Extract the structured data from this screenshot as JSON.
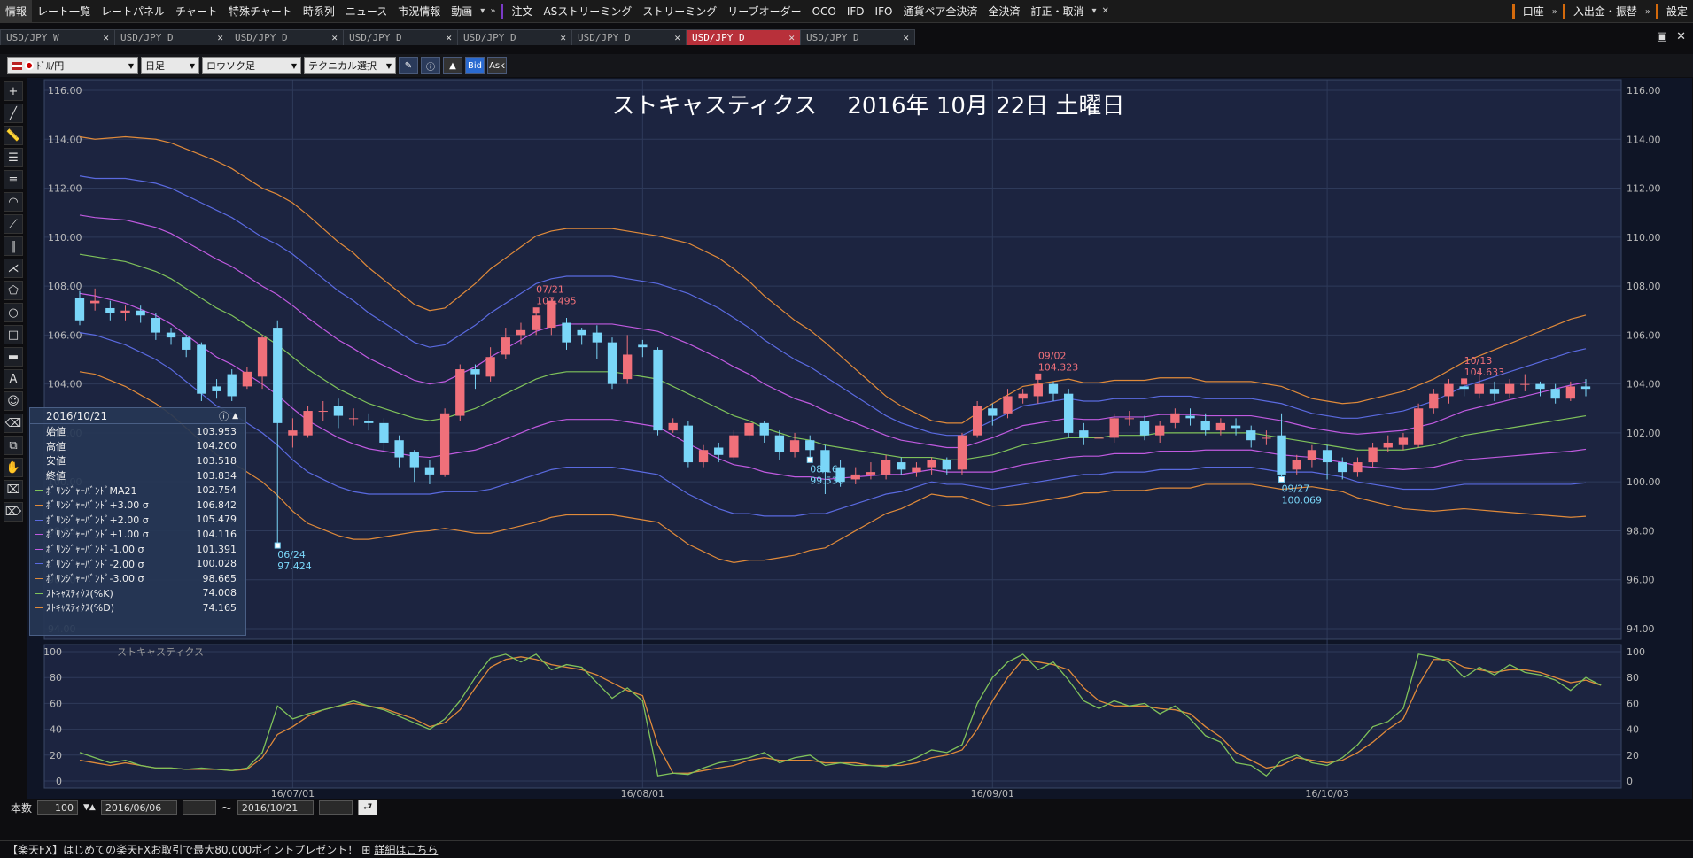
{
  "menu": {
    "left_items": [
      "情報",
      "レート一覧",
      "レートパネル",
      "チャート",
      "特殊チャート",
      "時系列",
      "ニュース",
      "市況情報",
      "動画"
    ],
    "order_items": [
      "注文",
      "ASストリーミング",
      "ストリーミング",
      "リーブオーダー",
      "OCO",
      "IFD",
      "IFO",
      "通貨ペア全決済",
      "全決済",
      "訂正・取消"
    ],
    "account": "口座",
    "deposit": "入出金・振替",
    "settings": "設定"
  },
  "tabs": [
    {
      "label": "USD/JPY W",
      "active": false
    },
    {
      "label": "USD/JPY D",
      "active": false
    },
    {
      "label": "USD/JPY D",
      "active": false
    },
    {
      "label": "USD/JPY D",
      "active": false
    },
    {
      "label": "USD/JPY D",
      "active": false
    },
    {
      "label": "USD/JPY D",
      "active": false
    },
    {
      "label": "USD/JPY D",
      "active": true
    },
    {
      "label": "USD/JPY D",
      "active": false
    }
  ],
  "toolbar": {
    "pair": "ﾄﾞﾙ/円",
    "period": "日足",
    "chart_type": "ロウソク足",
    "technical": "テクニカル選択",
    "bid": "Bid",
    "ask": "Ask"
  },
  "chart_title": "ストキャスティクス　 2016年 10月 22日 土曜日",
  "info_panel": {
    "date": "2016/10/21",
    "rows": [
      {
        "label": "始値",
        "value": "103.953",
        "color": ""
      },
      {
        "label": "高値",
        "value": "104.200",
        "color": ""
      },
      {
        "label": "安値",
        "value": "103.518",
        "color": ""
      },
      {
        "label": "終値",
        "value": "103.834",
        "color": ""
      },
      {
        "label": "ﾎﾞﾘﾝｼﾞｬｰﾊﾞﾝﾄﾞMA21",
        "value": "102.754",
        "color": "#7fc25a"
      },
      {
        "label": "ﾎﾞﾘﾝｼﾞｬｰﾊﾞﾝﾄﾞ+3.00 σ",
        "value": "106.842",
        "color": "#e08a3a"
      },
      {
        "label": "ﾎﾞﾘﾝｼﾞｬｰﾊﾞﾝﾄﾞ+2.00 σ",
        "value": "105.479",
        "color": "#5a6ae0"
      },
      {
        "label": "ﾎﾞﾘﾝｼﾞｬｰﾊﾞﾝﾄﾞ+1.00 σ",
        "value": "104.116",
        "color": "#c05ae0"
      },
      {
        "label": "ﾎﾞﾘﾝｼﾞｬｰﾊﾞﾝﾄﾞ-1.00 σ",
        "value": "101.391",
        "color": "#c05ae0"
      },
      {
        "label": "ﾎﾞﾘﾝｼﾞｬｰﾊﾞﾝﾄﾞ-2.00 σ",
        "value": "100.028",
        "color": "#5a6ae0"
      },
      {
        "label": "ﾎﾞﾘﾝｼﾞｬｰﾊﾞﾝﾄﾞ-3.00 σ",
        "value": "98.665",
        "color": "#e08a3a"
      },
      {
        "label": "ｽﾄｷｬｽﾃｨｸｽ(%K)",
        "value": "74.008",
        "color": "#7fc25a"
      },
      {
        "label": "ｽﾄｷｬｽﾃｨｸｽ(%D)",
        "value": "74.165",
        "color": "#e08a3a"
      }
    ]
  },
  "chart_data": {
    "type": "candlestick",
    "price_axis": {
      "min": 94,
      "max": 116,
      "ticks": [
        "116.00",
        "114.00",
        "112.00",
        "110.00",
        "108.00",
        "106.00",
        "104.00",
        "102.00",
        "100.00",
        "98.00",
        "96.00",
        "94.00"
      ]
    },
    "x_ticks": [
      "16/07/01",
      "16/08/01",
      "16/09/01",
      "16/10/03"
    ],
    "x_tick_index": [
      14,
      37,
      60,
      82
    ],
    "annotations": [
      {
        "date": "07/21",
        "value": "107.495",
        "index": 30,
        "kind": "high"
      },
      {
        "date": "06/24",
        "value": "97.424",
        "index": 13,
        "kind": "low"
      },
      {
        "date": "08/16",
        "value": "99.530",
        "index": 48,
        "kind": "low"
      },
      {
        "date": "09/02",
        "value": "104.323",
        "index": 63,
        "kind": "high"
      },
      {
        "date": "09/27",
        "value": "100.069",
        "index": 79,
        "kind": "low"
      },
      {
        "date": "10/13",
        "value": "104.633",
        "index": 91,
        "kind": "high"
      }
    ],
    "candles": [
      [
        107.5,
        106.6,
        107.8,
        106.4
      ],
      [
        107.3,
        107.4,
        107.9,
        107.0
      ],
      [
        107.1,
        106.9,
        107.4,
        106.6
      ],
      [
        106.9,
        107.0,
        107.2,
        106.6
      ],
      [
        107.0,
        106.8,
        107.2,
        106.5
      ],
      [
        106.7,
        106.1,
        106.9,
        105.8
      ],
      [
        106.1,
        105.9,
        106.3,
        105.6
      ],
      [
        105.9,
        105.4,
        106.0,
        105.1
      ],
      [
        105.6,
        103.6,
        105.7,
        103.3
      ],
      [
        103.9,
        103.7,
        104.2,
        103.4
      ],
      [
        104.4,
        103.5,
        104.6,
        103.3
      ],
      [
        103.9,
        104.5,
        104.7,
        103.8
      ],
      [
        104.3,
        105.9,
        106.0,
        103.8
      ],
      [
        106.3,
        102.4,
        106.6,
        97.4
      ],
      [
        101.9,
        102.1,
        102.6,
        101.4
      ],
      [
        101.9,
        102.9,
        103.1,
        101.8
      ],
      [
        102.9,
        102.9,
        103.3,
        102.5
      ],
      [
        103.1,
        102.7,
        103.4,
        102.2
      ],
      [
        102.6,
        102.6,
        103.0,
        102.3
      ],
      [
        102.5,
        102.4,
        102.8,
        102.1
      ],
      [
        102.4,
        101.6,
        102.6,
        101.2
      ],
      [
        101.7,
        101.0,
        101.9,
        100.6
      ],
      [
        101.2,
        100.6,
        101.3,
        100.0
      ],
      [
        100.6,
        100.3,
        100.9,
        99.9
      ],
      [
        100.3,
        102.8,
        103.0,
        100.2
      ],
      [
        102.7,
        104.6,
        104.8,
        102.5
      ],
      [
        104.6,
        104.4,
        104.8,
        103.8
      ],
      [
        104.3,
        105.1,
        105.5,
        104.1
      ],
      [
        105.2,
        105.9,
        106.3,
        105.0
      ],
      [
        106.0,
        106.2,
        106.5,
        105.6
      ],
      [
        106.2,
        106.8,
        107.0,
        106.0
      ],
      [
        106.3,
        107.4,
        107.5,
        106.0
      ],
      [
        106.5,
        105.7,
        106.7,
        105.4
      ],
      [
        106.2,
        106.0,
        106.3,
        105.6
      ],
      [
        106.1,
        105.7,
        106.4,
        105.0
      ],
      [
        105.7,
        104.0,
        105.9,
        103.8
      ],
      [
        104.2,
        105.2,
        106.0,
        104.0
      ],
      [
        105.6,
        105.5,
        105.8,
        105.1
      ],
      [
        105.4,
        102.1,
        105.5,
        101.9
      ],
      [
        102.1,
        102.4,
        102.6,
        102.0
      ],
      [
        102.3,
        100.8,
        102.5,
        100.6
      ],
      [
        100.8,
        101.3,
        101.5,
        100.6
      ],
      [
        101.4,
        101.1,
        101.6,
        100.8
      ],
      [
        101.0,
        101.9,
        102.1,
        100.9
      ],
      [
        101.9,
        102.4,
        102.6,
        101.7
      ],
      [
        102.4,
        101.9,
        102.5,
        101.6
      ],
      [
        101.9,
        101.2,
        102.1,
        100.9
      ],
      [
        101.2,
        101.7,
        102.0,
        101.0
      ],
      [
        101.7,
        101.3,
        101.9,
        100.9
      ],
      [
        101.3,
        100.4,
        101.5,
        99.5
      ],
      [
        100.6,
        100.0,
        100.9,
        99.8
      ],
      [
        100.1,
        100.3,
        100.6,
        99.9
      ],
      [
        100.3,
        100.4,
        100.8,
        100.1
      ],
      [
        100.3,
        100.9,
        101.1,
        100.1
      ],
      [
        100.8,
        100.5,
        101.0,
        100.3
      ],
      [
        100.4,
        100.6,
        100.8,
        100.2
      ],
      [
        100.6,
        100.9,
        101.0,
        100.3
      ],
      [
        100.9,
        100.5,
        101.0,
        100.3
      ],
      [
        100.5,
        101.9,
        102.0,
        100.3
      ],
      [
        101.9,
        103.1,
        103.3,
        101.8
      ],
      [
        103.0,
        102.7,
        103.2,
        102.3
      ],
      [
        102.8,
        103.5,
        103.8,
        102.6
      ],
      [
        103.4,
        103.6,
        103.8,
        103.2
      ],
      [
        103.5,
        104.0,
        104.3,
        103.2
      ],
      [
        104.0,
        103.6,
        104.1,
        103.3
      ],
      [
        103.6,
        102.0,
        103.8,
        101.8
      ],
      [
        102.1,
        101.8,
        102.4,
        101.5
      ],
      [
        101.8,
        101.8,
        102.2,
        101.5
      ],
      [
        101.8,
        102.6,
        102.8,
        101.6
      ],
      [
        102.6,
        102.6,
        102.9,
        102.3
      ],
      [
        102.5,
        101.9,
        102.7,
        101.7
      ],
      [
        101.9,
        102.3,
        102.5,
        101.6
      ],
      [
        102.4,
        102.8,
        103.0,
        102.2
      ],
      [
        102.7,
        102.6,
        103.0,
        102.3
      ],
      [
        102.5,
        102.1,
        102.8,
        101.9
      ],
      [
        102.1,
        102.4,
        102.6,
        101.9
      ],
      [
        102.3,
        102.2,
        102.6,
        101.9
      ],
      [
        102.1,
        101.7,
        102.3,
        101.4
      ],
      [
        101.8,
        101.8,
        102.1,
        101.5
      ],
      [
        101.9,
        100.3,
        102.8,
        100.1
      ],
      [
        100.5,
        100.9,
        101.1,
        100.3
      ],
      [
        100.9,
        101.3,
        101.5,
        100.6
      ],
      [
        101.3,
        100.8,
        101.5,
        100.1
      ],
      [
        100.8,
        100.4,
        101.0,
        100.1
      ],
      [
        100.4,
        100.8,
        101.0,
        100.2
      ],
      [
        100.8,
        101.4,
        101.6,
        100.6
      ],
      [
        101.4,
        101.6,
        101.9,
        101.2
      ],
      [
        101.5,
        101.8,
        102.0,
        101.3
      ],
      [
        101.5,
        103.0,
        103.2,
        101.4
      ],
      [
        103.0,
        103.6,
        103.8,
        102.8
      ],
      [
        103.5,
        104.0,
        104.2,
        103.2
      ],
      [
        103.9,
        103.8,
        104.1,
        103.5
      ],
      [
        103.6,
        104.0,
        104.6,
        103.4
      ],
      [
        103.8,
        103.6,
        104.1,
        103.3
      ],
      [
        103.6,
        104.0,
        104.2,
        103.4
      ],
      [
        104.0,
        104.0,
        104.4,
        103.7
      ],
      [
        104.0,
        103.8,
        104.1,
        103.5
      ],
      [
        103.8,
        103.4,
        104.0,
        103.2
      ],
      [
        103.4,
        103.9,
        104.1,
        103.3
      ],
      [
        103.9,
        103.8,
        104.2,
        103.5
      ]
    ],
    "bollinger": {
      "ma21": [
        109.3,
        109.2,
        109.1,
        109.0,
        108.8,
        108.6,
        108.3,
        107.9,
        107.5,
        107.1,
        106.8,
        106.4,
        106.0,
        105.6,
        105.1,
        104.6,
        104.2,
        103.8,
        103.5,
        103.2,
        103.0,
        102.8,
        102.6,
        102.5,
        102.6,
        102.8,
        103.0,
        103.3,
        103.6,
        103.9,
        104.2,
        104.4,
        104.5,
        104.5,
        104.5,
        104.5,
        104.4,
        104.3,
        104.2,
        103.9,
        103.6,
        103.3,
        103.0,
        102.7,
        102.5,
        102.2,
        102.0,
        101.8,
        101.7,
        101.5,
        101.4,
        101.3,
        101.2,
        101.1,
        101.0,
        101.0,
        101.0,
        100.9,
        100.9,
        101.0,
        101.1,
        101.3,
        101.5,
        101.6,
        101.7,
        101.8,
        101.8,
        101.8,
        101.9,
        101.9,
        101.9,
        102.0,
        102.0,
        102.0,
        102.0,
        102.0,
        102.0,
        102.0,
        101.9,
        101.8,
        101.7,
        101.6,
        101.5,
        101.4,
        101.3,
        101.3,
        101.3,
        101.3,
        101.4,
        101.5,
        101.7,
        101.9,
        102.0,
        102.1,
        102.2,
        102.3,
        102.4,
        102.5,
        102.6,
        102.7
      ],
      "sd": [
        1.6,
        1.6,
        1.65,
        1.7,
        1.75,
        1.8,
        1.85,
        1.9,
        1.95,
        2.0,
        2.0,
        2.0,
        2.0,
        2.05,
        2.1,
        2.1,
        2.05,
        2.0,
        1.95,
        1.85,
        1.75,
        1.65,
        1.55,
        1.5,
        1.5,
        1.6,
        1.7,
        1.8,
        1.85,
        1.9,
        1.95,
        1.95,
        1.95,
        1.95,
        1.95,
        1.95,
        1.95,
        1.95,
        1.95,
        2.0,
        2.05,
        2.05,
        2.05,
        2.0,
        1.9,
        1.8,
        1.7,
        1.6,
        1.5,
        1.4,
        1.25,
        1.1,
        0.95,
        0.8,
        0.7,
        0.6,
        0.5,
        0.5,
        0.5,
        0.6,
        0.7,
        0.75,
        0.8,
        0.8,
        0.8,
        0.8,
        0.75,
        0.75,
        0.75,
        0.75,
        0.75,
        0.75,
        0.75,
        0.75,
        0.7,
        0.7,
        0.7,
        0.7,
        0.7,
        0.7,
        0.65,
        0.6,
        0.6,
        0.6,
        0.65,
        0.7,
        0.75,
        0.8,
        0.85,
        0.9,
        0.95,
        1.0,
        1.05,
        1.1,
        1.15,
        1.2,
        1.25,
        1.3,
        1.35,
        1.37
      ]
    },
    "stochastic": {
      "y_ticks": [
        100,
        80,
        60,
        40,
        20,
        0
      ],
      "title": "ストキャスティクス",
      "k": [
        22,
        18,
        14,
        16,
        12,
        10,
        10,
        9,
        10,
        9,
        8,
        10,
        22,
        58,
        48,
        52,
        55,
        58,
        62,
        58,
        55,
        50,
        45,
        40,
        48,
        62,
        80,
        95,
        98,
        92,
        98,
        86,
        90,
        88,
        76,
        64,
        72,
        62,
        4,
        6,
        5,
        10,
        14,
        16,
        18,
        22,
        14,
        18,
        20,
        12,
        14,
        12,
        12,
        11,
        14,
        18,
        24,
        22,
        28,
        60,
        80,
        92,
        98,
        86,
        92,
        78,
        62,
        56,
        62,
        58,
        60,
        52,
        58,
        48,
        35,
        30,
        14,
        12,
        4,
        16,
        20,
        14,
        12,
        18,
        28,
        42,
        46,
        56,
        98,
        96,
        92,
        80,
        88,
        82,
        90,
        84,
        82,
        78,
        70,
        80,
        74
      ],
      "d": [
        16,
        14,
        12,
        14,
        12,
        10,
        10,
        9,
        9,
        9,
        8,
        9,
        18,
        36,
        42,
        50,
        55,
        58,
        60,
        58,
        56,
        52,
        48,
        42,
        45,
        55,
        72,
        88,
        94,
        96,
        94,
        90,
        88,
        86,
        82,
        76,
        70,
        66,
        28,
        6,
        6,
        8,
        10,
        12,
        16,
        18,
        16,
        16,
        16,
        14,
        14,
        14,
        12,
        12,
        12,
        14,
        18,
        20,
        24,
        40,
        62,
        80,
        94,
        92,
        90,
        86,
        72,
        62,
        58,
        58,
        58,
        56,
        55,
        52,
        42,
        34,
        22,
        16,
        10,
        12,
        18,
        16,
        14,
        16,
        22,
        30,
        40,
        48,
        74,
        94,
        94,
        88,
        86,
        84,
        86,
        86,
        84,
        80,
        76,
        78,
        74
      ]
    }
  },
  "range_bar": {
    "count_label": "本数",
    "count_value": "100",
    "from_date": "2016/06/06",
    "tilde": "～",
    "to_date": "2016/10/21"
  },
  "promo": {
    "text": "【楽天FX】はじめての楽天FXお取引で最大80,000ポイントプレゼント！",
    "link": "詳細はこちら"
  },
  "colors": {
    "chart_bg": "#1c2440",
    "up": "#f0707a",
    "down": "#7ad6f8",
    "grid": "#2e3a5a",
    "ma": "#7fc25a",
    "band1": "#c05ae0",
    "band2": "#5a6ae0",
    "band3": "#e08a3a"
  }
}
